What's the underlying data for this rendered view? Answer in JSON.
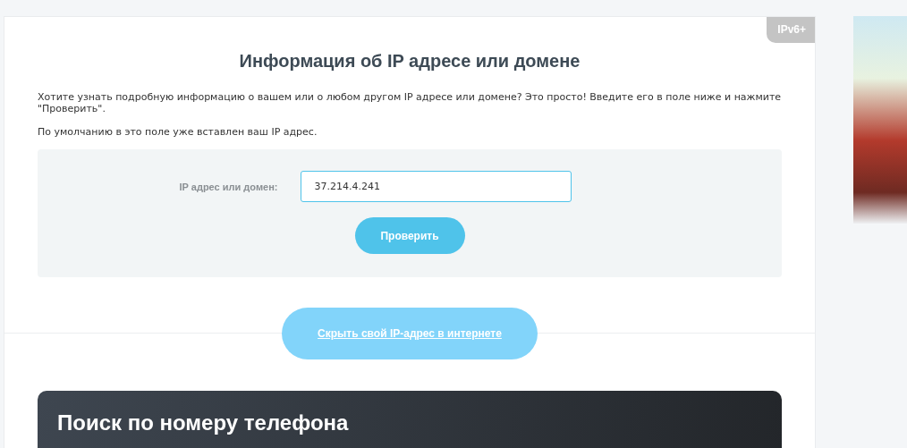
{
  "badge": "IPv6+",
  "title": "Информация об IP адресе или домене",
  "paragraphs": [
    "Хотите узнать подробную информацию о вашем или о любом другом IP адресе или домене? Это просто! Введите его в поле ниже и нажмите \"Проверить\".",
    "По умолчанию в это поле уже вставлен ваш IP адрес."
  ],
  "form": {
    "label": "IP адрес или домен:",
    "value": "37.214.4.241",
    "button": "Проверить"
  },
  "hide_ip_link": "Скрыть свой IP-адрес в интернете",
  "phone_card": {
    "title": "Поиск по номеру телефона"
  }
}
